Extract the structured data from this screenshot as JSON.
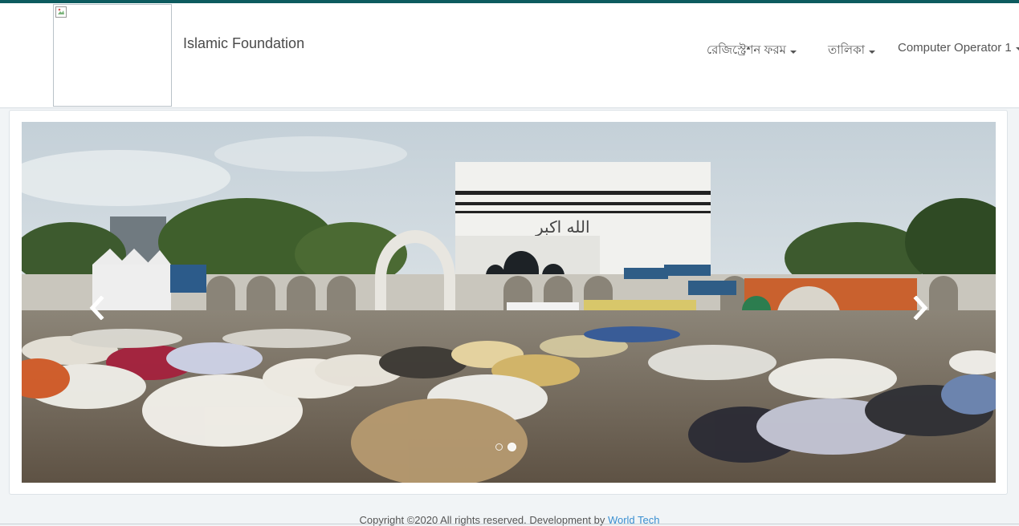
{
  "brand": {
    "name": "Islamic Foundation"
  },
  "nav": {
    "items": [
      {
        "label": "রেজিস্ট্রেশন ফরম"
      },
      {
        "label": "তালিকা"
      },
      {
        "label": "Computer Operator 1"
      }
    ]
  },
  "carousel": {
    "banner_arabic": "الله اكبر",
    "slide_count": 2,
    "active_slide": 2
  },
  "footer": {
    "text": "Copyright ©2020 All rights reserved. Development by ",
    "link_label": "World Tech"
  },
  "colors": {
    "accent": "#0d5b5f",
    "link": "#3a8fd1"
  }
}
